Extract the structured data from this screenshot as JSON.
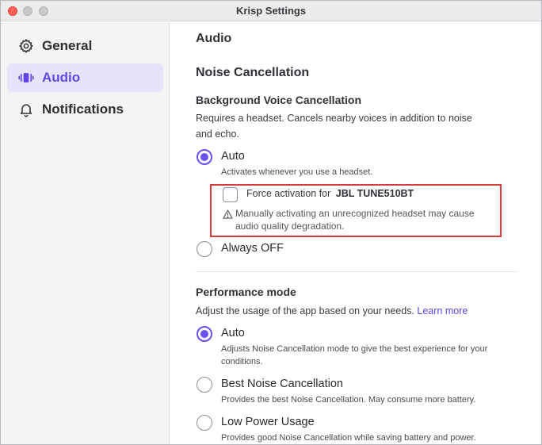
{
  "window": {
    "title": "Krisp Settings"
  },
  "sidebar": {
    "items": [
      {
        "label": "General",
        "icon": "gear-icon",
        "active": false
      },
      {
        "label": "Audio",
        "icon": "audio-icon",
        "active": true
      },
      {
        "label": "Notifications",
        "icon": "bell-icon",
        "active": false
      }
    ]
  },
  "main": {
    "title": "Audio",
    "noise_cancellation": {
      "heading": "Noise Cancellation",
      "bvc": {
        "heading": "Background Voice Cancellation",
        "description_line1": "Requires a headset. Cancels nearby voices in addition to noise",
        "description_line2": "and echo.",
        "options": [
          {
            "label": "Auto",
            "description": "Activates whenever you use a headset.",
            "checked": true
          },
          {
            "label": "Always OFF",
            "description": "",
            "checked": false
          }
        ],
        "force": {
          "label": "Force activation for",
          "device": "JBL TUNE510BT",
          "checked": false,
          "warning_line1": "Manually activating an unrecognized headset may cause",
          "warning_line2": "audio quality degradation."
        }
      }
    },
    "performance": {
      "heading": "Performance mode",
      "description": "Adjust the usage of the app based on your needs.",
      "learn_more": "Learn more",
      "options": [
        {
          "label": "Auto",
          "description_line1": "Adjusts Noise Cancellation mode to give the best experience for your",
          "description_line2": "conditions.",
          "checked": true
        },
        {
          "label": "Best Noise Cancellation",
          "description_line1": "Provides the best Noise Cancellation. May consume more battery.",
          "description_line2": "",
          "checked": false
        },
        {
          "label": "Low Power Usage",
          "description_line1": "Provides good Noise Cancellation while saving battery and power.",
          "description_line2": "",
          "checked": false
        }
      ]
    }
  },
  "colors": {
    "accent": "#6a4ff0",
    "highlight_border": "#d83a3a",
    "close_button": "#fe5f57"
  }
}
